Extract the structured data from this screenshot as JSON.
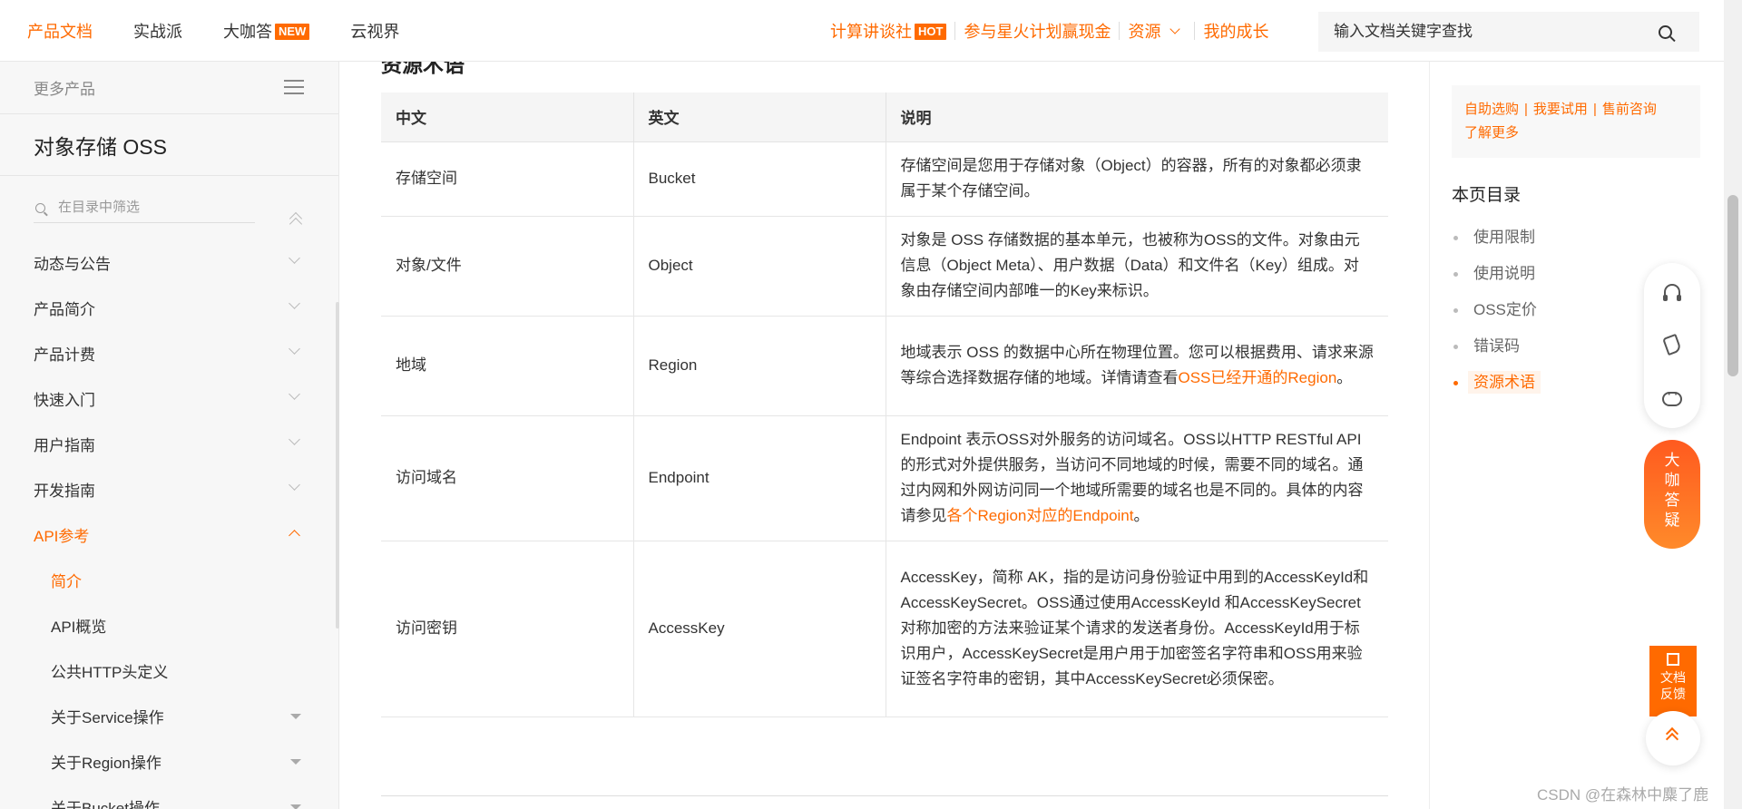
{
  "topnav": {
    "left": [
      {
        "label": "产品文档",
        "active": true
      },
      {
        "label": "实战派"
      },
      {
        "label": "大咖答",
        "badge": "NEW"
      },
      {
        "label": "云视界"
      }
    ],
    "right": {
      "community": "计算讲谈社",
      "community_badge": "HOT",
      "campaign": "参与星火计划赢现金",
      "resources": "资源",
      "growth": "我的成长"
    },
    "search_placeholder": "输入文档关键字查找"
  },
  "sidebar": {
    "more": "更多产品",
    "product": "对象存储 OSS",
    "filter_placeholder": "在目录中筛选",
    "items": [
      {
        "label": "动态与公告"
      },
      {
        "label": "产品简介"
      },
      {
        "label": "产品计费"
      },
      {
        "label": "快速入门"
      },
      {
        "label": "用户指南"
      },
      {
        "label": "开发指南"
      },
      {
        "label": "API参考"
      },
      {
        "label": "简介"
      },
      {
        "label": "API概览"
      },
      {
        "label": "公共HTTP头定义"
      },
      {
        "label": "关于Service操作"
      },
      {
        "label": "关于Region操作"
      },
      {
        "label": "关于Bucket操作"
      }
    ]
  },
  "content": {
    "section_title": "资源术语",
    "headers": [
      "中文",
      "英文",
      "说明"
    ],
    "rows": [
      {
        "cn": "存储空间",
        "en": "Bucket",
        "desc": "存储空间是您用于存储对象（Object）的容器，所有的对象都必须隶属于某个存储空间。"
      },
      {
        "cn": "对象/文件",
        "en": "Object",
        "desc": "对象是 OSS 存储数据的基本单元，也被称为OSS的文件。对象由元信息（Object Meta）、用户数据（Data）和文件名（Key）组成。对象由存储空间内部唯一的Key来标识。"
      },
      {
        "cn": "地域",
        "en": "Region",
        "desc": "地域表示 OSS 的数据中心所在物理位置。您可以根据费用、请求来源等综合选择数据存储的地域。详情请查看",
        "link": "OSS已经开通的Region",
        "tail": "。"
      },
      {
        "cn": "访问域名",
        "en": "Endpoint",
        "desc": "Endpoint 表示OSS对外服务的访问域名。OSS以HTTP RESTful API的形式对外提供服务，当访问不同地域的时候，需要不同的域名。通过内网和外网访问同一个地域所需要的域名也是不同的。具体的内容请参见",
        "link": "各个Region对应的Endpoint",
        "tail": "。"
      },
      {
        "cn": "访问密钥",
        "en": "AccessKey",
        "desc": "AccessKey，简称 AK，指的是访问身份验证中用到的AccessKeyId和AccessKeySecret。OSS通过使用AccessKeyId 和AccessKeySecret对称加密的方法来验证某个请求的发送者身份。AccessKeyId用于标识用户，AccessKeySecret是用户用于加密签名字符串和OSS用来验证签名字符串的密钥，其中AccessKeySecret必须保密。"
      }
    ]
  },
  "right": {
    "promo": [
      "自助选购",
      "我要试用",
      "售前咨询",
      "了解更多"
    ],
    "toc_title": "本页目录",
    "toc": [
      {
        "label": "使用限制"
      },
      {
        "label": "使用说明"
      },
      {
        "label": "OSS定价"
      },
      {
        "label": "错误码"
      },
      {
        "label": "资源术语",
        "active": true
      }
    ]
  },
  "floating": {
    "ask": [
      "大",
      "咖",
      "答",
      "疑"
    ],
    "feedback": [
      "文档",
      "反馈"
    ]
  },
  "watermark": "CSDN @在森林中麋了鹿"
}
